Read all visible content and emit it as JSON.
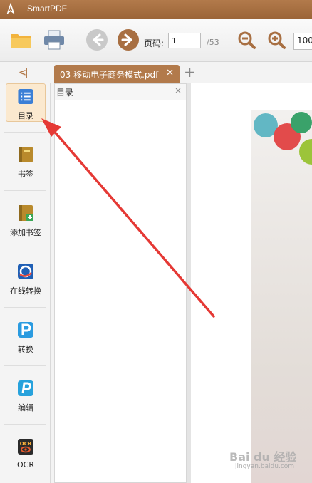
{
  "app": {
    "title": "SmartPDF"
  },
  "toolbar": {
    "page_label": "页码:",
    "page_value": "1",
    "page_total": "/53",
    "zoom_value": "100"
  },
  "tabs": {
    "collapse_glyph": "<|",
    "doc_tab_label": "03 移动电子商务模式.pdf",
    "doc_tab_close": "✕",
    "new_tab": "+"
  },
  "sidebar": {
    "items": [
      {
        "label": "目录",
        "icon": "list-icon",
        "active": true
      },
      {
        "label": "书签",
        "icon": "bookmark-icon"
      },
      {
        "label": "添加书签",
        "icon": "add-bookmark-icon"
      },
      {
        "label": "在线转换",
        "icon": "online-convert-icon"
      },
      {
        "label": "转换",
        "icon": "convert-icon"
      },
      {
        "label": "编辑",
        "icon": "edit-icon"
      },
      {
        "label": "OCR",
        "icon": "ocr-icon"
      }
    ]
  },
  "toc": {
    "title": "目录",
    "close": "×"
  },
  "watermark": {
    "text": "Bai du 经验",
    "sub": "jingyan.baidu.com"
  },
  "colors": {
    "accent": "#b27a4b",
    "annotation": "#e53935",
    "active_bg": "#fbe9cf"
  }
}
